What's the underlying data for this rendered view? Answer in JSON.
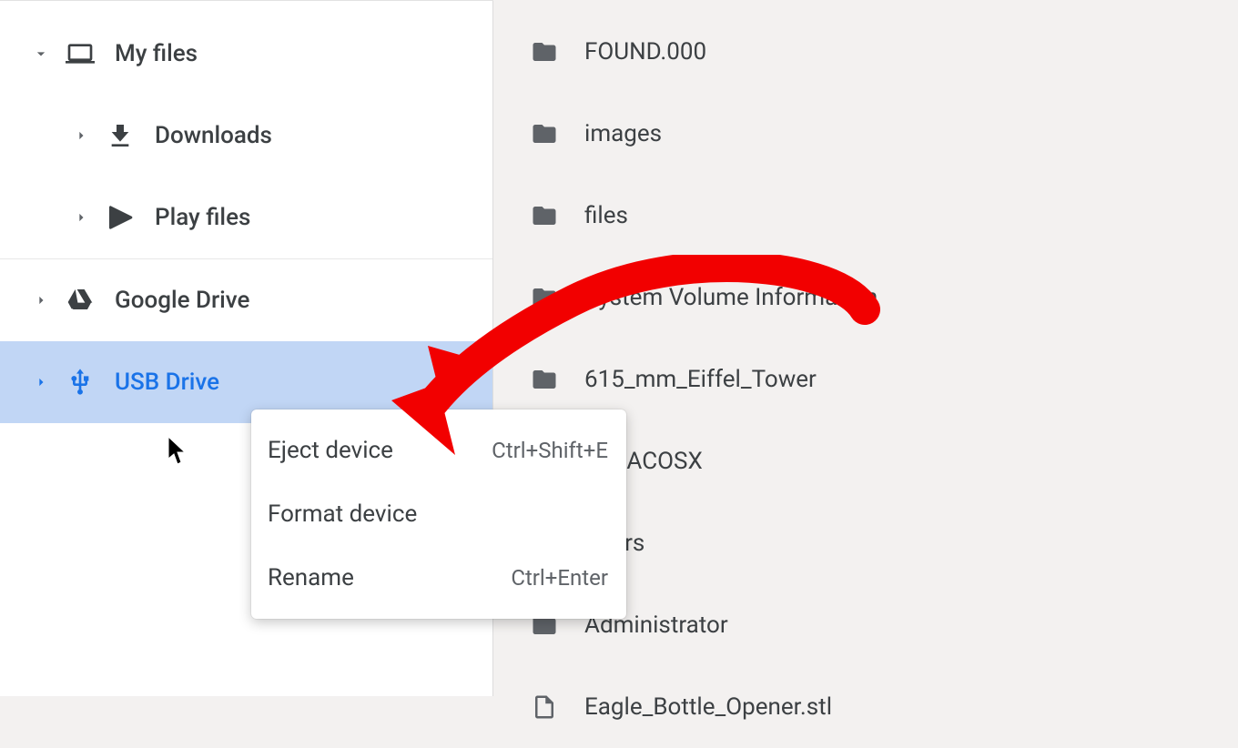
{
  "sidebar": {
    "items": [
      {
        "label": "My files",
        "icon": "laptop",
        "level": 0,
        "expanded": true,
        "selected": false
      },
      {
        "label": "Downloads",
        "icon": "download",
        "level": 1,
        "expanded": false,
        "selected": false
      },
      {
        "label": "Play files",
        "icon": "play",
        "level": 1,
        "expanded": false,
        "selected": false
      },
      {
        "label": "Google Drive",
        "icon": "drive",
        "level": 0,
        "expanded": false,
        "selected": false
      },
      {
        "label": "USB Drive",
        "icon": "usb",
        "level": 0,
        "expanded": false,
        "selected": true
      }
    ]
  },
  "files": [
    {
      "name": "FOUND.000",
      "type": "folder"
    },
    {
      "name": "images",
      "type": "folder"
    },
    {
      "name": "files",
      "type": "folder"
    },
    {
      "name": "System Volume Information",
      "type": "folder"
    },
    {
      "name": "615_mm_Eiffel_Tower",
      "type": "folder"
    },
    {
      "name": "__MACOSX",
      "type": "folder"
    },
    {
      "name": "Users",
      "type": "folder"
    },
    {
      "name": "Administrator",
      "type": "folder"
    },
    {
      "name": "Eagle_Bottle_Opener.stl",
      "type": "file"
    }
  ],
  "context_menu": {
    "items": [
      {
        "label": "Eject device",
        "shortcut": "Ctrl+Shift+E"
      },
      {
        "label": "Format device",
        "shortcut": ""
      },
      {
        "label": "Rename",
        "shortcut": "Ctrl+Enter"
      }
    ]
  },
  "annotation": {
    "arrow_color": "#f20000"
  }
}
